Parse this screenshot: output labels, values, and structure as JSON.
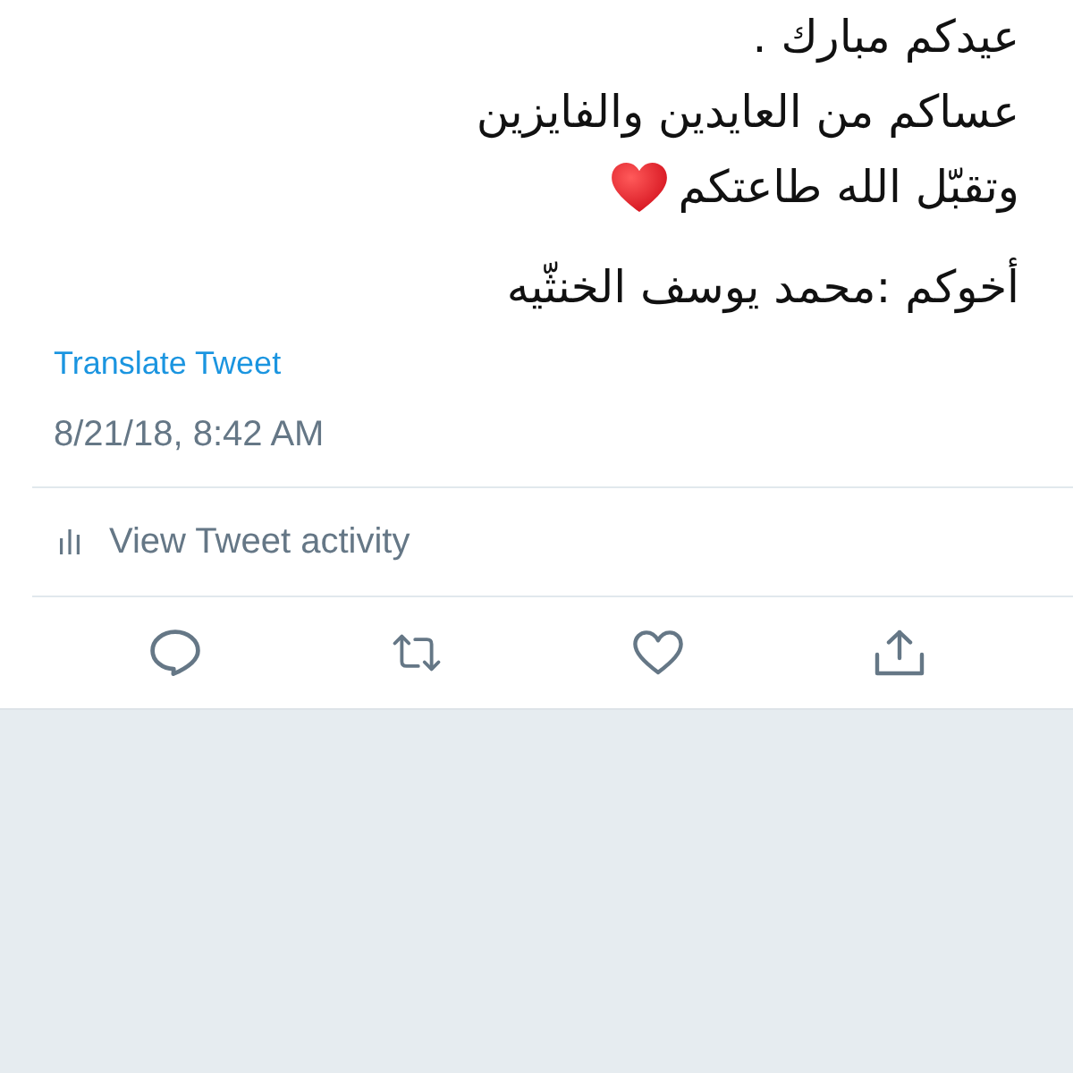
{
  "tweet": {
    "paragraphs": [
      {
        "lines": [
          {
            "text": "عيدكم مبارك .",
            "kind": "plain"
          },
          {
            "text": "عساكم من العايدين والفايزين",
            "kind": "plain"
          },
          {
            "text": "وتقبّل الله طاعتكم",
            "kind": "heart_emoji"
          }
        ]
      },
      {
        "lines": [
          {
            "text": "أخوكم :محمد يوسف الخنثّيه",
            "kind": "plain"
          }
        ]
      }
    ],
    "translate_link": "Translate Tweet",
    "timestamp": "8/21/18, 8:42 AM"
  },
  "activity": {
    "label": "View Tweet activity"
  },
  "actions": [
    {
      "kind": "reply"
    },
    {
      "kind": "retweet"
    },
    {
      "kind": "like"
    },
    {
      "kind": "share"
    }
  ]
}
